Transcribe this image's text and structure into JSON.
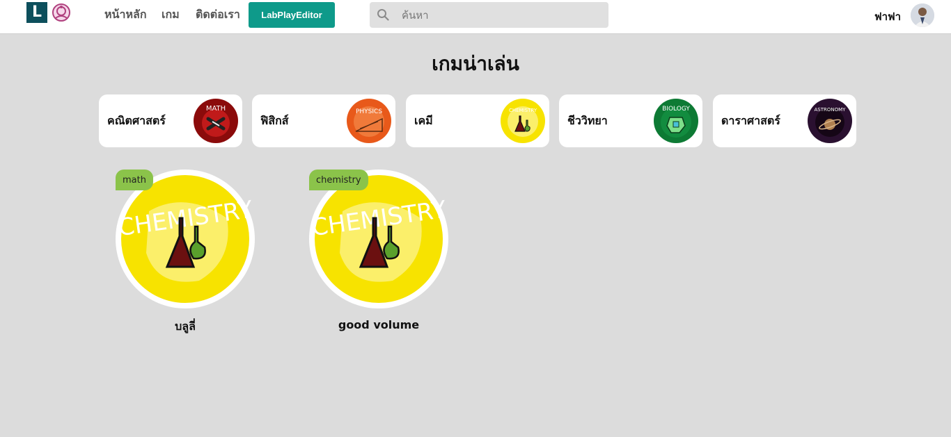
{
  "header": {
    "logo_letter": "L",
    "nav": [
      "หน้าหลัก",
      "เกม",
      "ติดต่อเรา"
    ],
    "editor_button": "LabPlayEditor",
    "search_placeholder": "ค้นหา",
    "username": "ฟาฟา"
  },
  "main": {
    "title": "เกมน่าเล่น",
    "categories": [
      {
        "label": "คณิตศาสตร์",
        "badge": "MATH",
        "color": "#8b0b0b"
      },
      {
        "label": "ฟิสิกส์",
        "badge": "PHYSICS",
        "color": "#e8591a"
      },
      {
        "label": "เคมี",
        "badge": "CHEMISTRY",
        "color": "#f7e300"
      },
      {
        "label": "ชีววิทยา",
        "badge": "BIOLOGY",
        "color": "#0d7a34"
      },
      {
        "label": "ดาราศาสตร์",
        "badge": "ASTRONOMY",
        "color": "#2a1030"
      }
    ],
    "games": [
      {
        "tag": "math",
        "title": "บลูลี่",
        "badge": "CHEMISTRY"
      },
      {
        "tag": "chemistry",
        "title": "good volume",
        "badge": "CHEMISTRY"
      }
    ]
  },
  "colors": {
    "accent": "#0e9a8a",
    "tag": "#8bc34a",
    "background": "#dcdcdc"
  }
}
